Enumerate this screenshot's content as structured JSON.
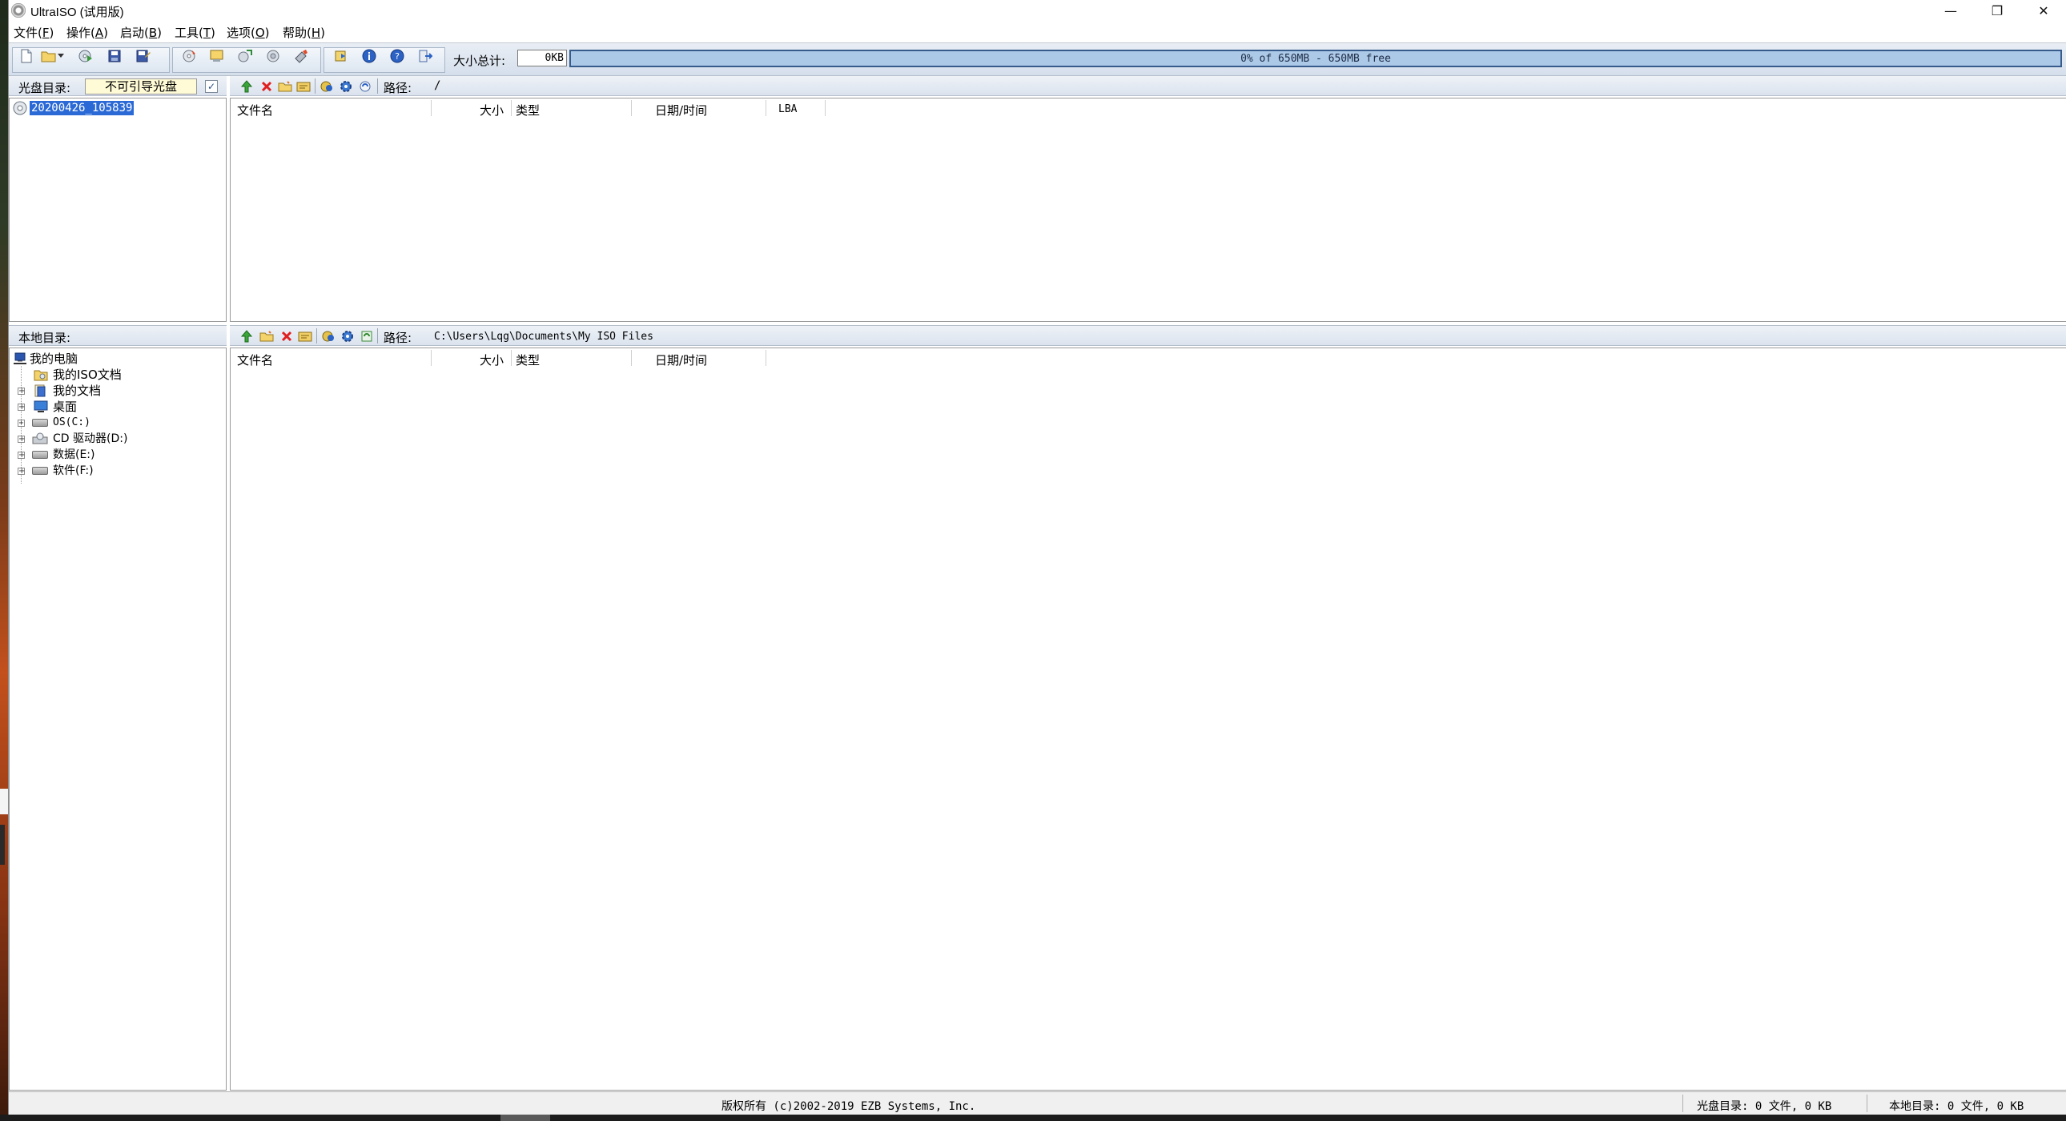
{
  "window": {
    "title": "UltraISO (试用版)",
    "controls": {
      "minimize": "—",
      "restore": "❐",
      "close": "✕"
    }
  },
  "menu": [
    {
      "label": "文件(",
      "key": "F",
      "end": ")"
    },
    {
      "label": "操作(",
      "key": "A",
      "end": ")"
    },
    {
      "label": "启动(",
      "key": "B",
      "end": ")"
    },
    {
      "label": "工具(",
      "key": "T",
      "end": ")"
    },
    {
      "label": "选项(",
      "key": "O",
      "end": ")"
    },
    {
      "label": "帮助(",
      "key": "H",
      "end": ")"
    }
  ],
  "toolbar": {
    "size_label": "大小总计:",
    "size_value": "0KB",
    "capacity_text": "0% of 650MB - 650MB free",
    "capacity_fraction": 0.0,
    "icons": [
      "new-icon",
      "open-icon",
      "open-dropdown-icon",
      "disc-open-icon",
      "save-icon",
      "save-as-icon",
      "burn-icon",
      "cd-image-icon",
      "extract-icon",
      "mount-icon",
      "virtual-drive-icon",
      "compress-icon",
      "properties-icon",
      "help-icon",
      "exit-icon"
    ]
  },
  "disc_pane": {
    "label": "光盘目录:",
    "boot_status": "不可引导光盘",
    "root_node": "20200426_105839",
    "path_label": "路径:",
    "path_value": "/",
    "columns": [
      "文件名",
      "大小",
      "类型",
      "日期/时间",
      "LBA"
    ]
  },
  "local_pane": {
    "label": "本地目录:",
    "path_label": "路径:",
    "path_value": "C:\\Users\\Lqg\\Documents\\My ISO Files",
    "columns": [
      "文件名",
      "大小",
      "类型",
      "日期/时间"
    ],
    "tree": {
      "root": "我的电脑",
      "items": [
        "我的ISO文档",
        "我的文档",
        "桌面",
        "OS(C:)",
        "CD 驱动器(D:)",
        "数据(E:)",
        "软件(F:)"
      ]
    }
  },
  "status": {
    "copyright": "版权所有 (c)2002-2019 EZB Systems, Inc.",
    "disc_summary": "光盘目录: 0 文件, 0 KB",
    "local_summary": "本地目录: 0 文件, 0 KB"
  }
}
